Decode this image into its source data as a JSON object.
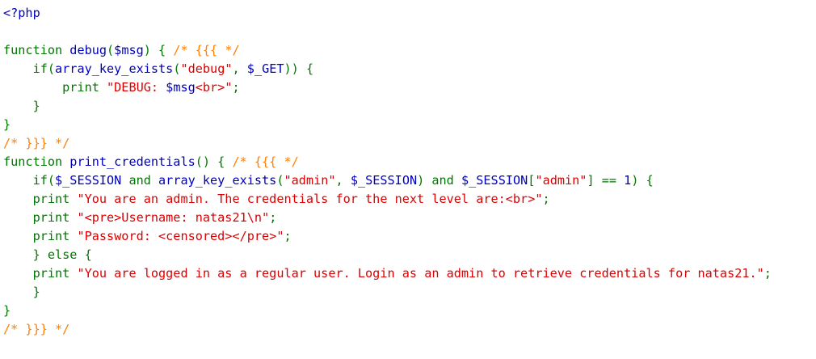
{
  "source": {
    "language": "php",
    "colors": {
      "default": "#0000bb",
      "keyword": "#007700",
      "string": "#dd0000",
      "comment": "#ff8000"
    },
    "lines": [
      [
        {
          "t": "default",
          "v": "<?php"
        }
      ],
      [],
      [
        {
          "t": "keyword",
          "v": "function "
        },
        {
          "t": "default",
          "v": "debug"
        },
        {
          "t": "keyword",
          "v": "("
        },
        {
          "t": "default",
          "v": "$msg"
        },
        {
          "t": "keyword",
          "v": ") { "
        },
        {
          "t": "comment",
          "v": "/* {{{ */"
        }
      ],
      [
        {
          "t": "keyword",
          "v": "    if("
        },
        {
          "t": "default",
          "v": "array_key_exists"
        },
        {
          "t": "keyword",
          "v": "("
        },
        {
          "t": "string",
          "v": "\"debug\""
        },
        {
          "t": "keyword",
          "v": ", "
        },
        {
          "t": "default",
          "v": "$_GET"
        },
        {
          "t": "keyword",
          "v": ")) {"
        }
      ],
      [
        {
          "t": "keyword",
          "v": "        print "
        },
        {
          "t": "string",
          "v": "\"DEBUG: "
        },
        {
          "t": "default",
          "v": "$msg"
        },
        {
          "t": "string",
          "v": "<br>\""
        },
        {
          "t": "keyword",
          "v": ";"
        }
      ],
      [
        {
          "t": "keyword",
          "v": "    }"
        }
      ],
      [
        {
          "t": "keyword",
          "v": "}"
        }
      ],
      [
        {
          "t": "comment",
          "v": "/* }}} */"
        }
      ],
      [
        {
          "t": "keyword",
          "v": "function "
        },
        {
          "t": "default",
          "v": "print_credentials"
        },
        {
          "t": "keyword",
          "v": "() { "
        },
        {
          "t": "comment",
          "v": "/* {{{ */"
        }
      ],
      [
        {
          "t": "keyword",
          "v": "    if("
        },
        {
          "t": "default",
          "v": "$_SESSION "
        },
        {
          "t": "keyword",
          "v": "and "
        },
        {
          "t": "default",
          "v": "array_key_exists"
        },
        {
          "t": "keyword",
          "v": "("
        },
        {
          "t": "string",
          "v": "\"admin\""
        },
        {
          "t": "keyword",
          "v": ", "
        },
        {
          "t": "default",
          "v": "$_SESSION"
        },
        {
          "t": "keyword",
          "v": ") and "
        },
        {
          "t": "default",
          "v": "$_SESSION"
        },
        {
          "t": "keyword",
          "v": "["
        },
        {
          "t": "string",
          "v": "\"admin\""
        },
        {
          "t": "keyword",
          "v": "] == "
        },
        {
          "t": "default",
          "v": "1"
        },
        {
          "t": "keyword",
          "v": ") {"
        }
      ],
      [
        {
          "t": "keyword",
          "v": "    print "
        },
        {
          "t": "string",
          "v": "\"You are an admin. The credentials for the next level are:<br>\""
        },
        {
          "t": "keyword",
          "v": ";"
        }
      ],
      [
        {
          "t": "keyword",
          "v": "    print "
        },
        {
          "t": "string",
          "v": "\"<pre>Username: natas21\\n\""
        },
        {
          "t": "keyword",
          "v": ";"
        }
      ],
      [
        {
          "t": "keyword",
          "v": "    print "
        },
        {
          "t": "string",
          "v": "\"Password: <censored></pre>\""
        },
        {
          "t": "keyword",
          "v": ";"
        }
      ],
      [
        {
          "t": "keyword",
          "v": "    } else {"
        }
      ],
      [
        {
          "t": "keyword",
          "v": "    print "
        },
        {
          "t": "string",
          "v": "\"You are logged in as a regular user. Login as an admin to retrieve credentials for natas21.\""
        },
        {
          "t": "keyword",
          "v": ";"
        }
      ],
      [
        {
          "t": "keyword",
          "v": "    }"
        }
      ],
      [
        {
          "t": "keyword",
          "v": "}"
        }
      ],
      [
        {
          "t": "comment",
          "v": "/* }}} */"
        }
      ]
    ]
  }
}
